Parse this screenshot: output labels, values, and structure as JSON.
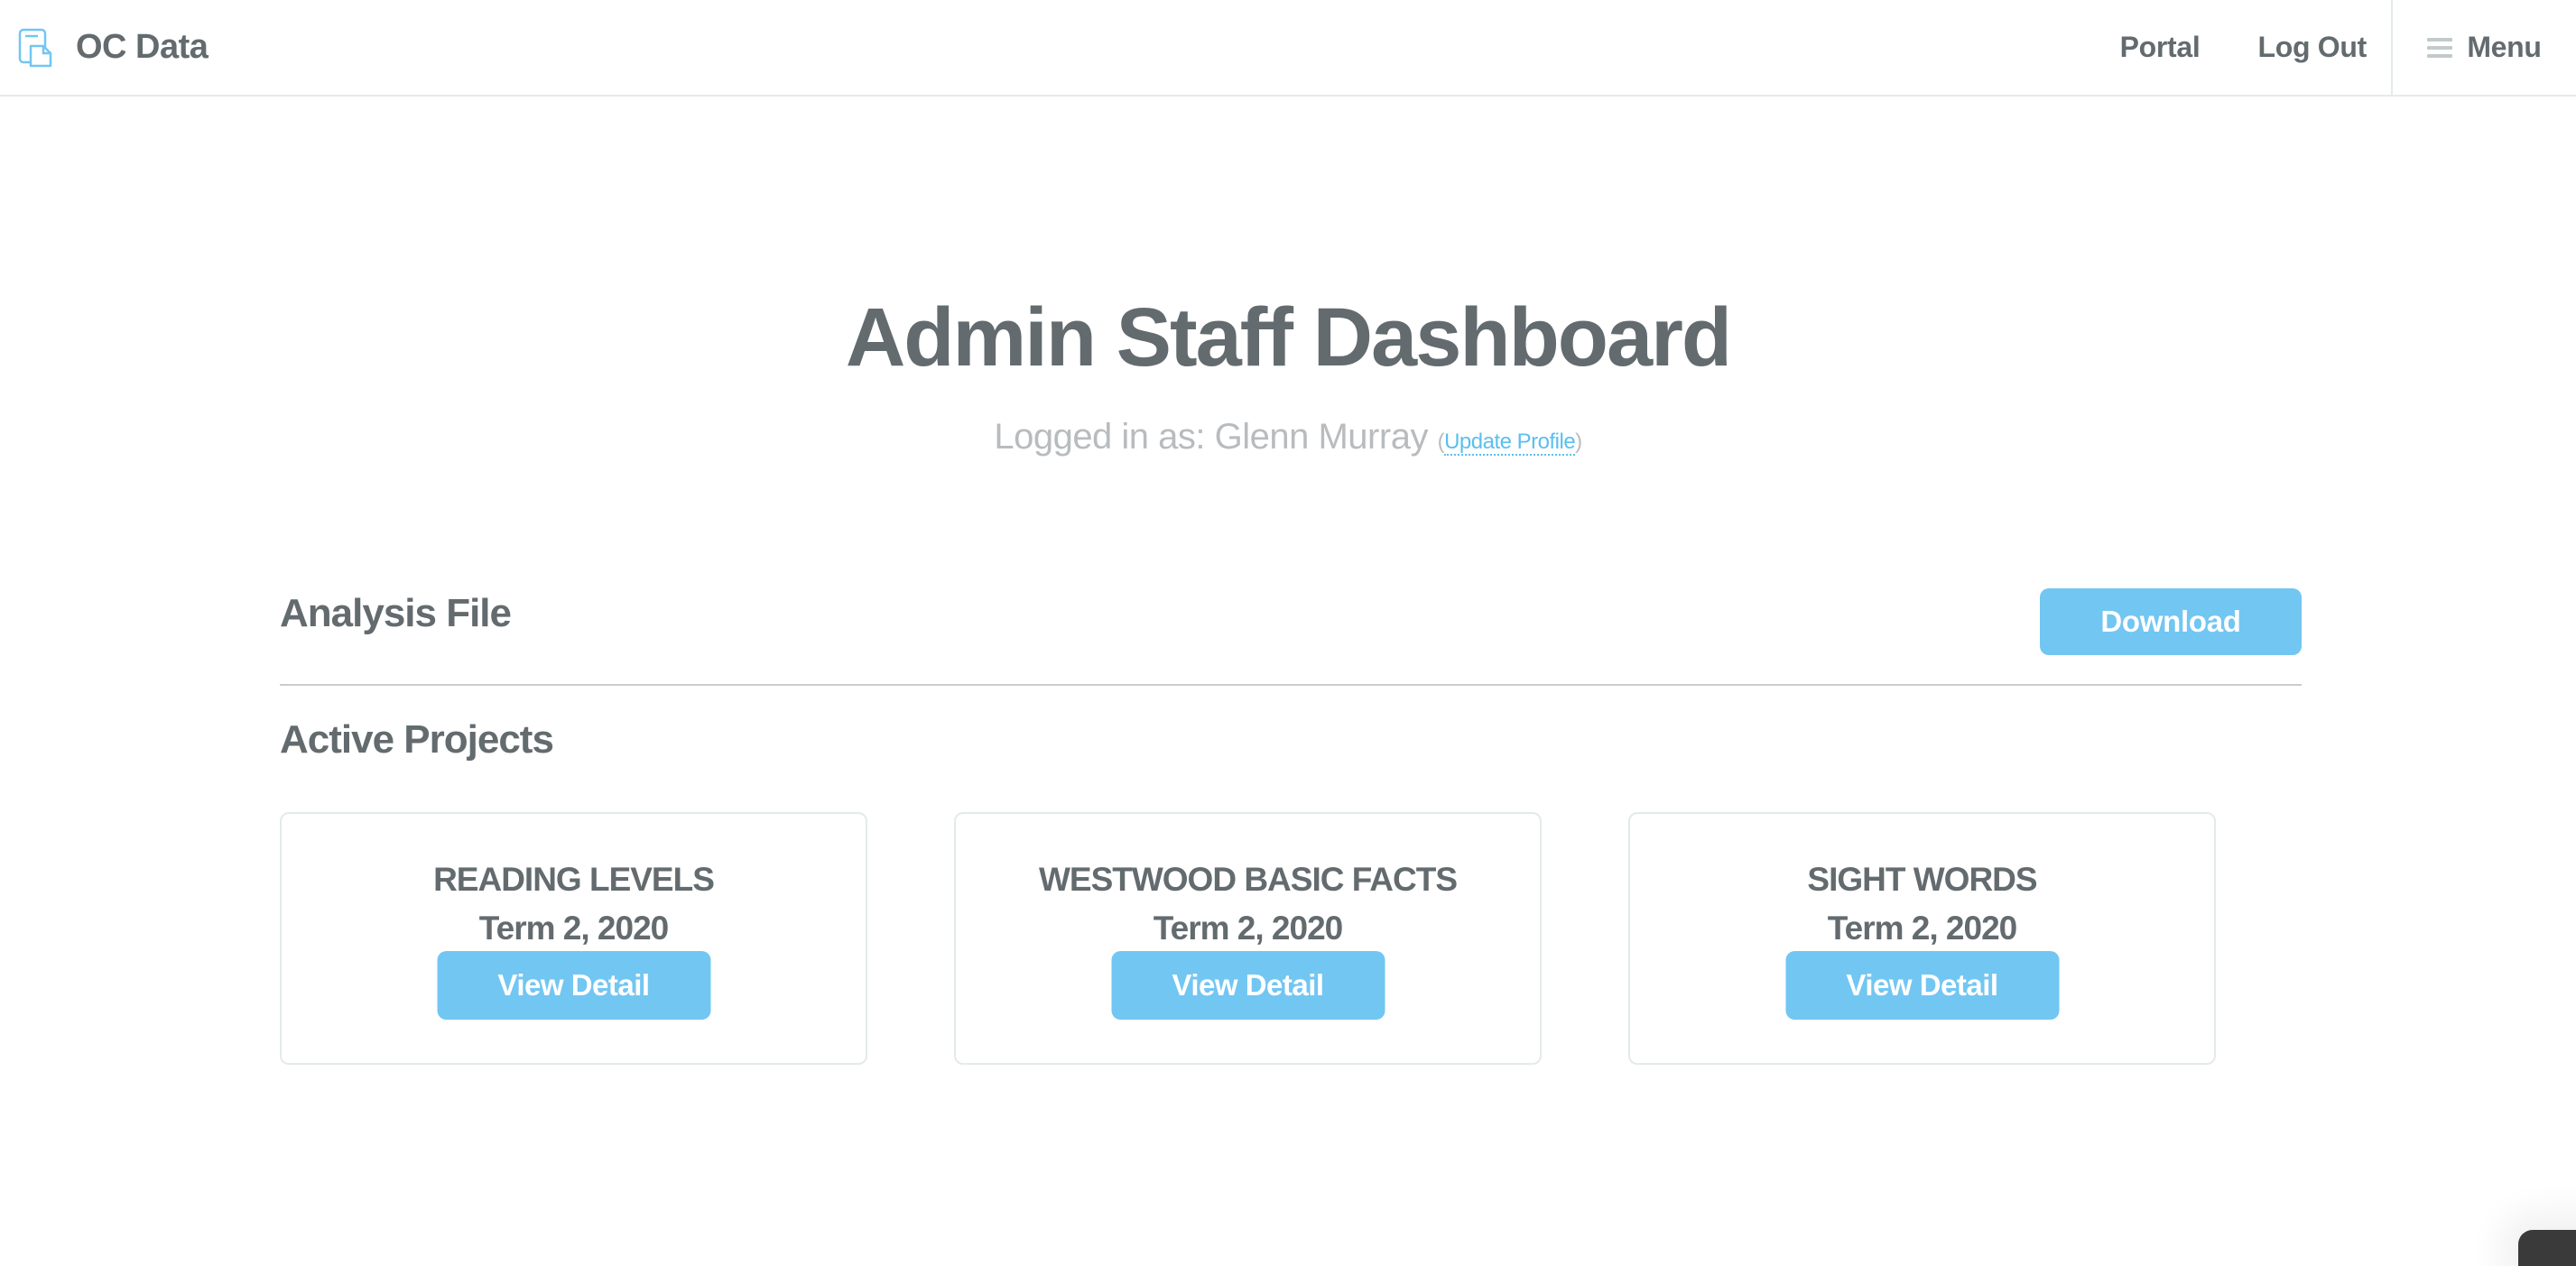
{
  "navbar": {
    "brand": {
      "icon": "files-icon",
      "label": "OC Data"
    },
    "links": [
      {
        "label": "Portal"
      },
      {
        "label": "Log Out"
      }
    ],
    "menu": {
      "icon": "hamburger-icon",
      "label": "Menu"
    }
  },
  "hero": {
    "title": "Admin Staff Dashboard",
    "logged_in_prefix": "Logged in as: Glenn Murray",
    "open_paren": "(",
    "update_profile_label": "Update Profile",
    "close_paren": ")"
  },
  "analysis": {
    "heading": "Analysis File",
    "download_label": "Download"
  },
  "projects": {
    "heading": "Active Projects",
    "items": [
      {
        "title": "READING LEVELS",
        "term": "Term 2, 2020",
        "button_label": "View Detail"
      },
      {
        "title": "WESTWOOD BASIC FACTS",
        "term": "Term 2, 2020",
        "button_label": "View Detail"
      },
      {
        "title": "SIGHT WORDS",
        "term": "Term 2, 2020",
        "button_label": "View Detail"
      }
    ]
  },
  "colors": {
    "text": "#636b6f",
    "muted": "#b8bcbf",
    "accent": "#72c6f2",
    "link": "#5bbfee",
    "border": "#e4eaec"
  }
}
